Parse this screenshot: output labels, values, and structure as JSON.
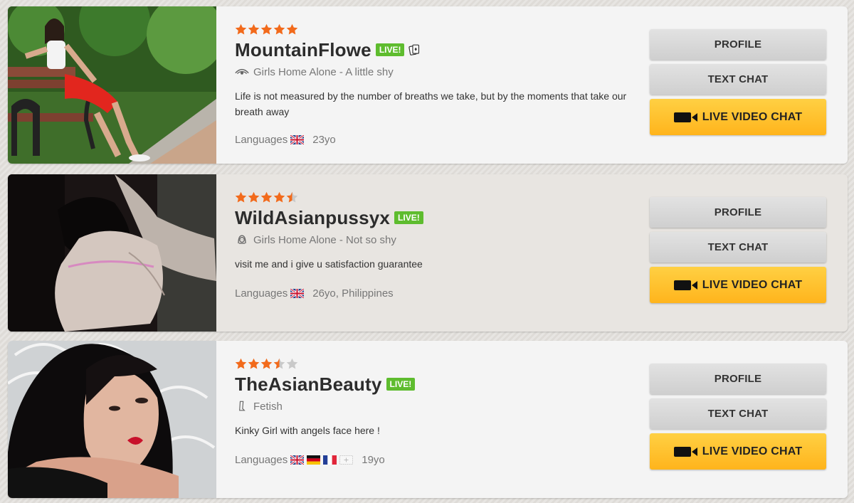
{
  "profiles": [
    {
      "name": "MountainFlowe",
      "live_badge": "LIVE!",
      "rating": 5,
      "category": "Girls Home Alone - A little shy",
      "category_icon": "eye-icon",
      "description": "Life is not measured by the number of breaths we take, but by the moments that take our breath away",
      "languages_label": "Languages",
      "flags": [
        "uk-flag"
      ],
      "age": "23yo",
      "extra_icon": "playing-cards-icon"
    },
    {
      "name": "WildAsianpussyx",
      "live_badge": "LIVE!",
      "rating": 4.5,
      "category": "Girls Home Alone - Not so shy",
      "category_icon": "shy-face-icon",
      "description": "visit me and i give u satisfaction guarantee",
      "languages_label": "Languages",
      "flags": [
        "uk-flag"
      ],
      "age": "26yo, Philippines"
    },
    {
      "name": "TheAsianBeauty",
      "live_badge": "LIVE!",
      "rating": 3.5,
      "category": "Fetish",
      "category_icon": "boot-icon",
      "description": "Kinky Girl with angels face here !",
      "languages_label": "Languages",
      "flags": [
        "uk-flag",
        "germany-flag",
        "france-flag",
        "other-language-flag"
      ],
      "age": "19yo"
    }
  ],
  "buttons": {
    "profile": "PROFILE",
    "text_chat": "TEXT CHAT",
    "live_video_chat": "LIVE VIDEO CHAT"
  },
  "colors": {
    "star_filled": "#f26a1b",
    "star_empty": "#c9c9c9",
    "live_badge": "#5ebc2e",
    "video_button": "#ffbf2a"
  }
}
